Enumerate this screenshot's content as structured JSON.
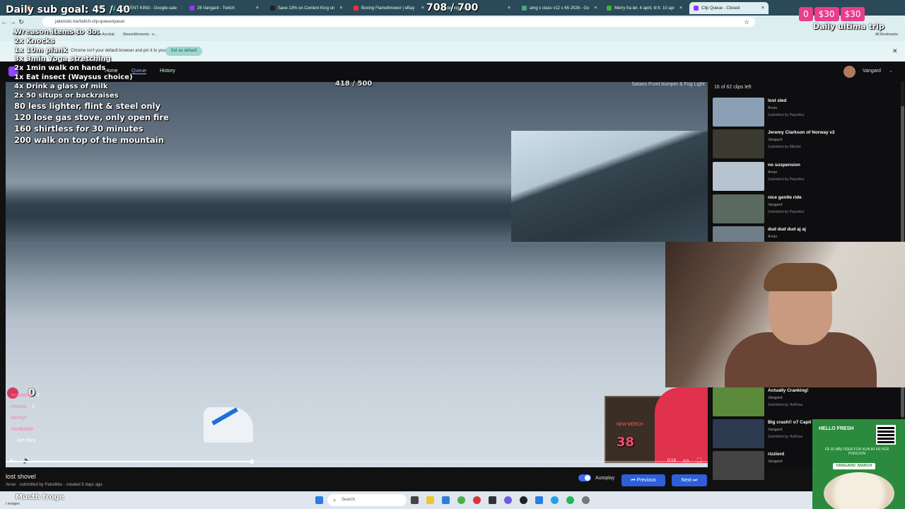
{
  "browser": {
    "tabs": [
      {
        "label": "",
        "color": "#e84"
      },
      {
        "label": "CONTENT KING - Google-sale",
        "color": "#2a8"
      },
      {
        "label": "26 Vangard - Twitch",
        "color": "#93f"
      },
      {
        "label": "Save 13% on Content King on",
        "color": "#222"
      },
      {
        "label": "Boxing Flamethrower | eBay",
        "color": "#e33"
      },
      {
        "label": "Opening Compr",
        "color": "#888"
      },
      {
        "label": "amg s class v12 s 65 2026 - Go",
        "color": "#4a8"
      },
      {
        "label": "Merry fra lør. 4 april, til fr. 10 apr",
        "color": "#3b3"
      },
      {
        "label": "Clip Queue - Closed",
        "color": "#93f"
      }
    ],
    "url": "jakeniski.me/twitch-clip-queue/queue",
    "bookmarks": [
      "Maps",
      "Twitch",
      "STREAMTOGETHER",
      "Adobe Acrobat",
      "StreamElements - o..."
    ],
    "all_bookmarks": "All Bookmarks",
    "infobar_text": "Chrome isn't your default browser and pin it to your taskbar",
    "set_default_label": "Set as default"
  },
  "overlay": {
    "goal": "Daily sub goal: 45 / 40",
    "counter": "708 / 700",
    "bits": [
      "0",
      "$30",
      "$30"
    ],
    "daily_title": "Daily ultima trip",
    "todo_lines": [
      "Wreason items to do:",
      "2x Knocks",
      "1x 10m plank",
      "3x 3min Yoga stretching",
      "2x 1min walk on hands",
      "1x Eat insect (Waysus choice)",
      "4x Drink a glass of milk",
      "2x 50 situps or backraises"
    ],
    "milestones": [
      "80 less lighter, flint & steel only",
      "120 lose gas stove, only open fire",
      "160 shirtless for 30 minutes",
      "200 walk on top of the mountain"
    ],
    "video_counter": "418 / 500",
    "sponsor_text": "Safaris Front bumper & Fog Light",
    "heart_count": "0",
    "chat": [
      {
        "name": "enstating",
        "msg": "1"
      },
      {
        "name": "rimzea",
        "msg": "1"
      },
      {
        "name": "kennyr",
        "msg": ""
      },
      {
        "name": "hardbattle",
        "msg": ""
      },
      {
        "name": "",
        "msg": "Are they"
      }
    ],
    "promo_number": "38",
    "promo_label": "NEW MERCH"
  },
  "app": {
    "nav": {
      "home": "Home",
      "queue": "Queue",
      "history": "History"
    },
    "user": "Vangard",
    "clip": {
      "title": "lost shovel",
      "sub": "Arrav · submitted by Paturikku · created 5 days ago"
    },
    "player": {
      "progress": 0.35,
      "time": "0:19"
    },
    "autoplay_label": "Autoplay",
    "previous_label": "Previous",
    "next_label": "Next",
    "queue_count": "16 of 62 clips left",
    "queue": [
      {
        "title": "lost sled",
        "author": "Arrav",
        "sub": "Submitted by Paturikku",
        "color": "#8ba0b5"
      },
      {
        "title": "Jeremy Clarkson of Norway v2",
        "author": "Vangard",
        "sub": "Submitted by Billydot",
        "color": "#3b3a30"
      },
      {
        "title": "no suspension",
        "author": "Arrav",
        "sub": "Submitted by Paturikku",
        "color": "#b7c3cf"
      },
      {
        "title": "nice gentle ride",
        "author": "Vangard",
        "sub": "Submitted by Paturikku",
        "color": "#5b6a60"
      },
      {
        "title": "dud dud dud aj aj",
        "author": "Arrav",
        "sub": "",
        "color": "#6f7e89"
      },
      {
        "title": "Actually Cranking!",
        "author": "Vangard",
        "sub": "Submitted by HaKKaa",
        "color": "#5b8a3a"
      },
      {
        "title": "Big crash!! o7 Capit",
        "author": "Vangard",
        "sub": "Submitted by HaKKaa",
        "color": "#2d3a50"
      },
      {
        "title": "rizzlord",
        "author": "Vangard",
        "sub": "",
        "color": "#444"
      }
    ]
  },
  "ad": {
    "brand": "HELLO FRESH",
    "text": "FÅ 20 MÅLTIDER FOR KUN 80 KR PER PORSJON",
    "code": "VANGARD_MARCH"
  },
  "taskbar": {
    "weather": "Musth froge",
    "weather_sub": "I morgen",
    "search": "Search"
  }
}
